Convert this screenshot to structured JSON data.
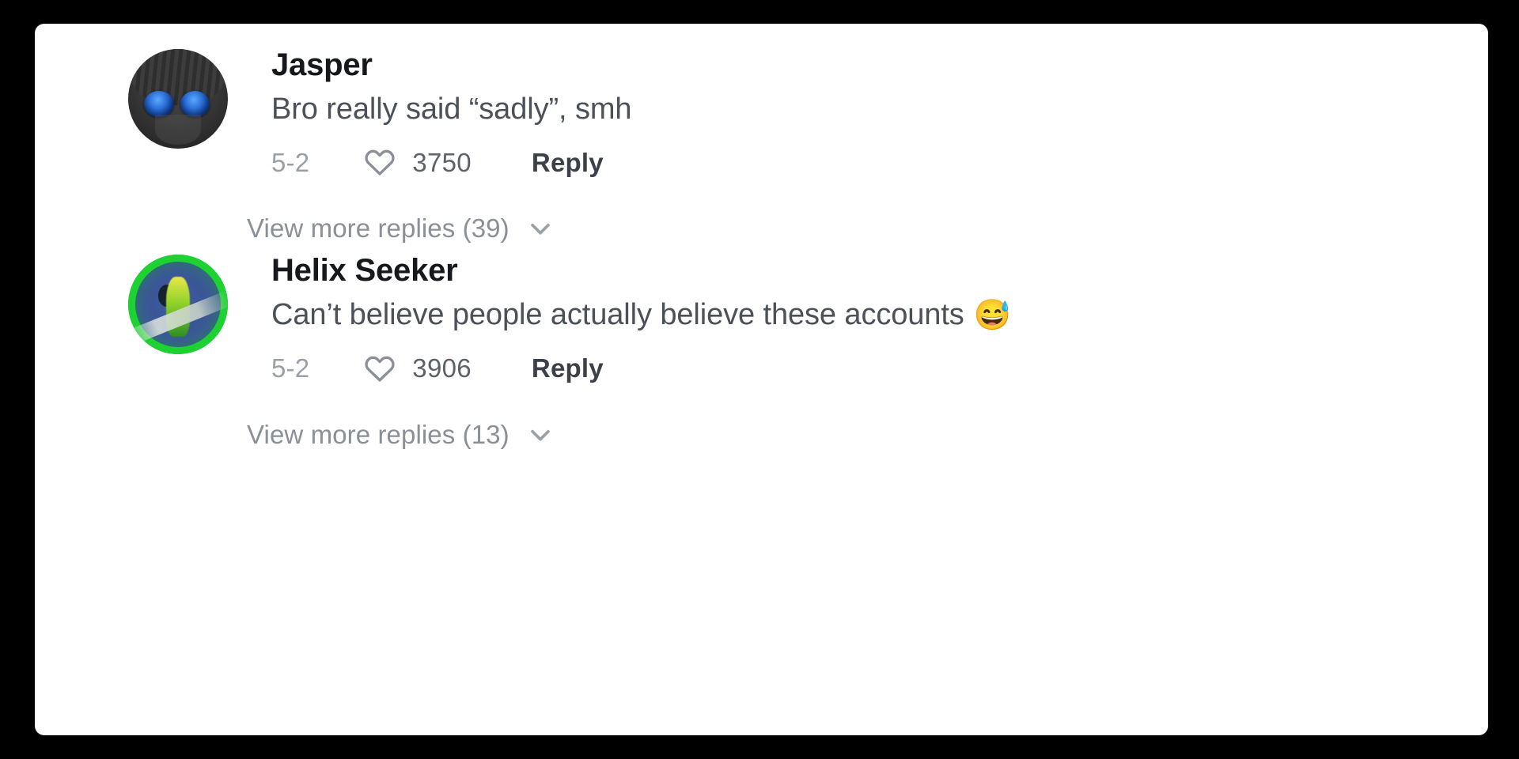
{
  "panel": {
    "background_color": "#ffffff",
    "page_background_color": "#000000"
  },
  "comments": [
    {
      "avatar_name": "avatar-jasper",
      "username": "Jasper",
      "text": "Bro really said “sadly”, smh",
      "emoji": "",
      "date": "5-2",
      "like_icon": "heart-icon",
      "likes": "3750",
      "reply_label": "Reply",
      "view_more_label": "View more replies (39)",
      "chevron_icon": "chevron-down-icon"
    },
    {
      "avatar_name": "avatar-helix-seeker",
      "username": "Helix Seeker",
      "text": "Can’t believe people actually believe these accounts",
      "emoji": "😅",
      "date": "5-2",
      "like_icon": "heart-icon",
      "likes": "3906",
      "reply_label": "Reply",
      "view_more_label": "View more replies (13)",
      "chevron_icon": "chevron-down-icon"
    }
  ]
}
